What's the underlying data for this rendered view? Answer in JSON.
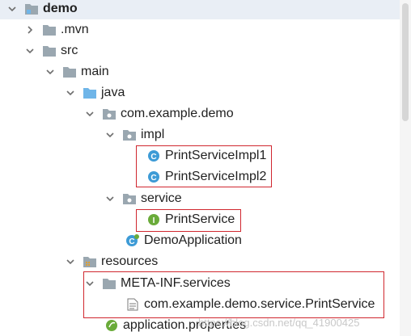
{
  "tree": {
    "items": [
      {
        "label": "demo",
        "icon": "project-folder-icon",
        "bold": true
      },
      {
        "label": ".mvn",
        "icon": "folder-icon"
      },
      {
        "label": "src",
        "icon": "folder-icon"
      },
      {
        "label": "main",
        "icon": "folder-icon"
      },
      {
        "label": "java",
        "icon": "source-folder-icon"
      },
      {
        "label": "com.example.demo",
        "icon": "package-icon"
      },
      {
        "label": "impl",
        "icon": "package-icon"
      },
      {
        "label": "PrintServiceImpl1",
        "icon": "class-icon"
      },
      {
        "label": "PrintServiceImpl2",
        "icon": "class-icon"
      },
      {
        "label": "service",
        "icon": "package-icon"
      },
      {
        "label": "PrintService",
        "icon": "interface-icon"
      },
      {
        "label": "DemoApplication",
        "icon": "spring-boot-class-icon"
      },
      {
        "label": "resources",
        "icon": "resources-folder-icon"
      },
      {
        "label": "META-INF.services",
        "icon": "folder-icon"
      },
      {
        "label": "com.example.demo.service.PrintService",
        "icon": "text-file-icon"
      },
      {
        "label": "application.properties",
        "icon": "properties-file-icon"
      }
    ]
  },
  "watermark": "https://blog.csdn.net/qq_41900425",
  "colors": {
    "highlight_border": "#d0272f",
    "selection_bg": "#e9eef5",
    "folder": "#9aa7b0",
    "source_folder": "#6fb5e8",
    "class_icon": "#3d9bd6",
    "interface_icon": "#6aab3a"
  }
}
